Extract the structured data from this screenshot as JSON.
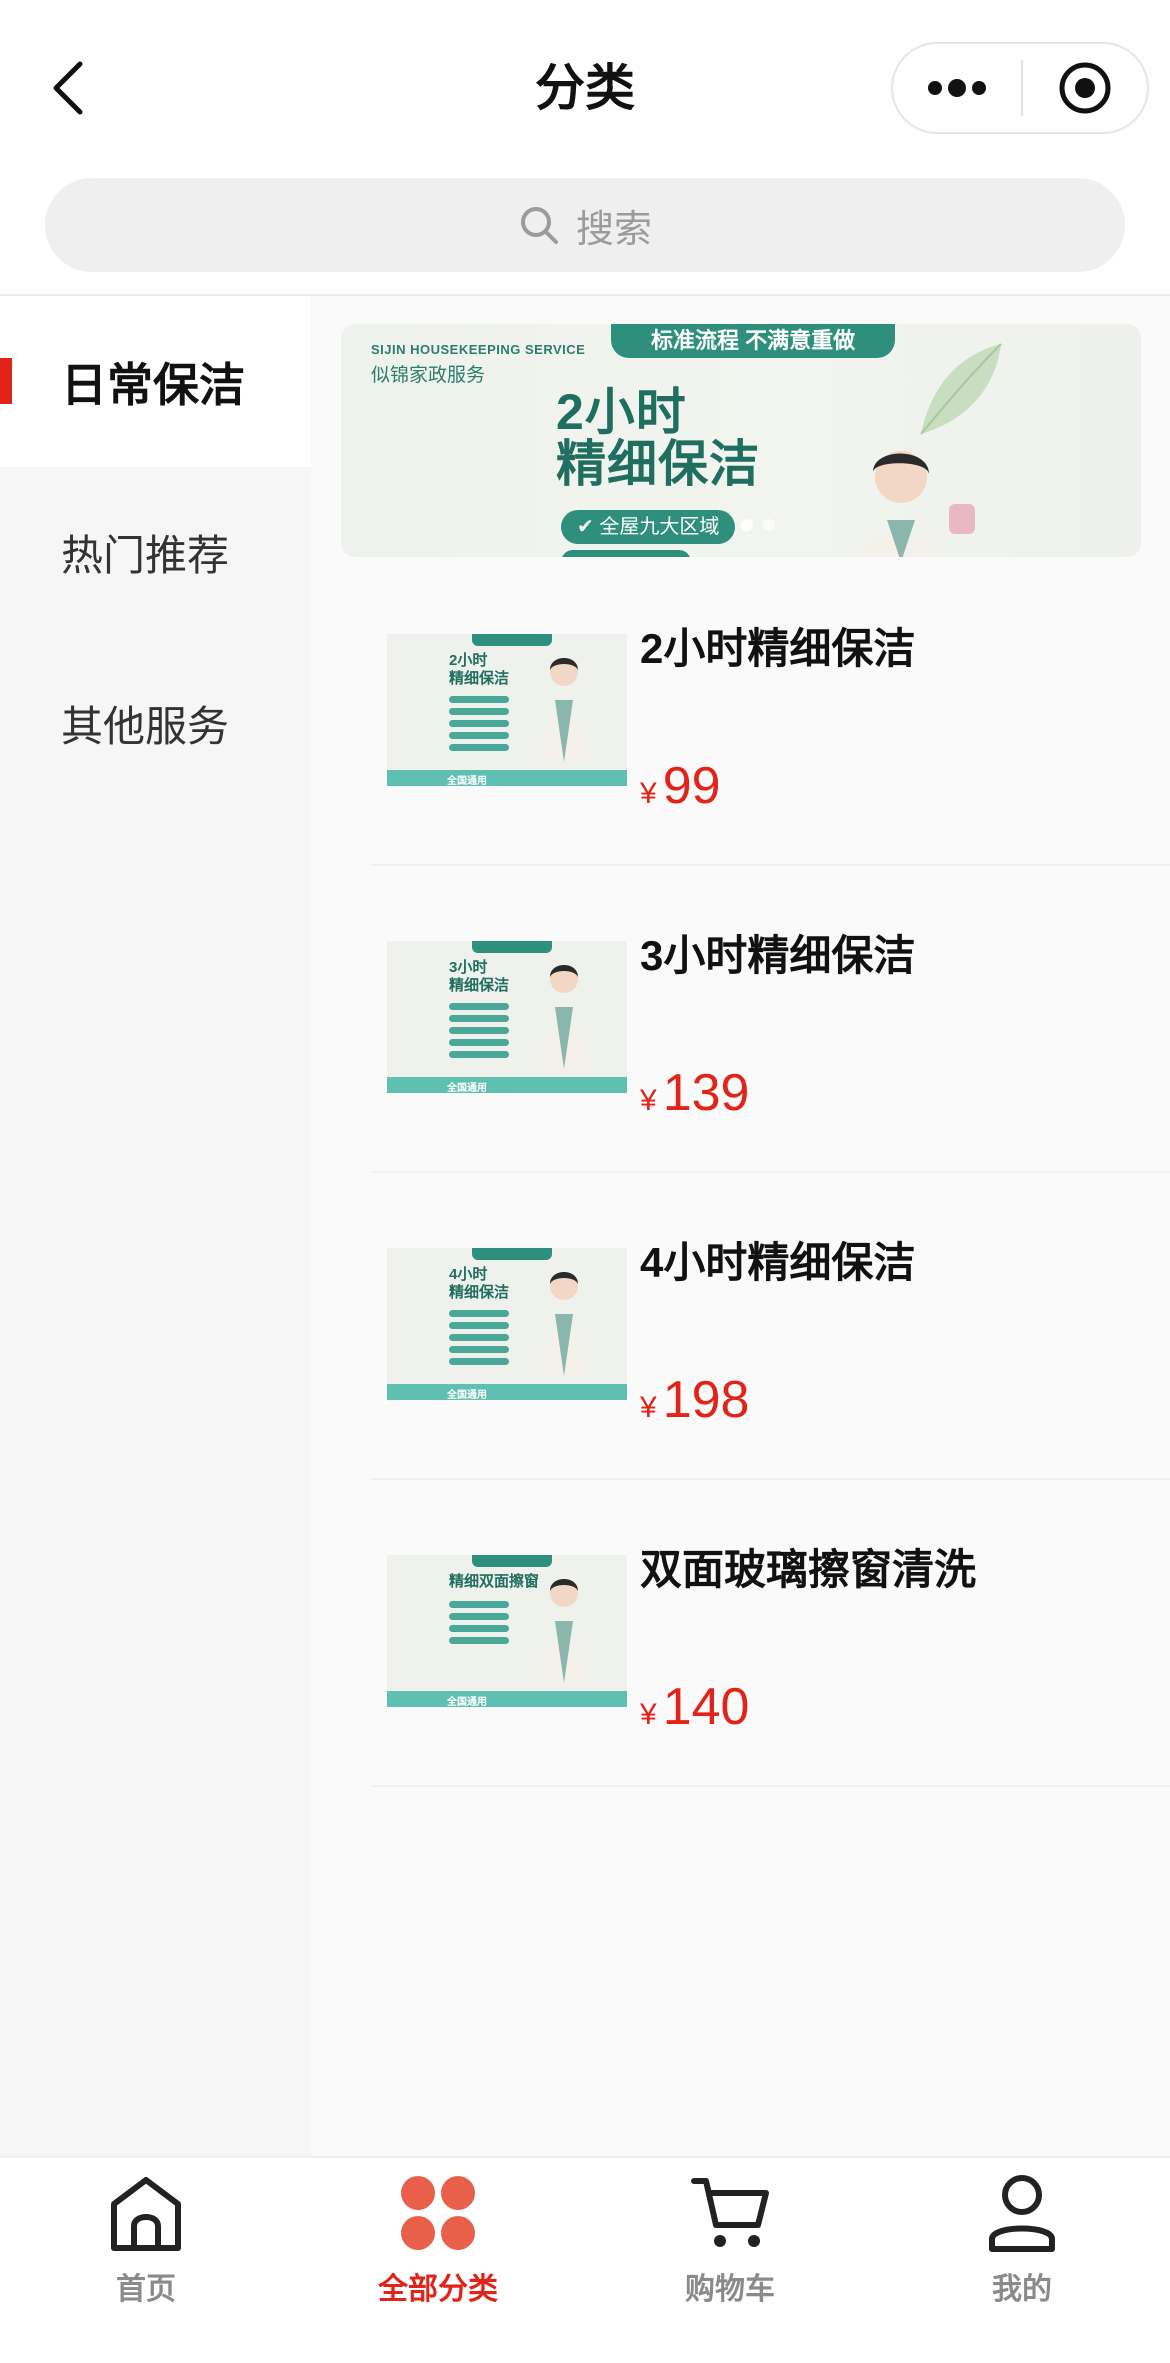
{
  "header": {
    "title": "分类",
    "back_icon": "chevron-left-icon",
    "more_icon": "more-dots-icon",
    "close_icon": "target-close-icon"
  },
  "search": {
    "placeholder": "搜索",
    "icon": "search-icon"
  },
  "sidebar": {
    "items": [
      {
        "label": "日常保洁",
        "active": true
      },
      {
        "label": "热门推荐",
        "active": false
      },
      {
        "label": "其他服务",
        "active": false
      }
    ]
  },
  "banner": {
    "tag": "标准流程  不满意重做",
    "brand_en": "SIJIN HOUSEKEEPING SERVICE",
    "brand_cn": "似锦家政服务",
    "headline": "2小时\n精细保洁",
    "pill": "全屋九大区域"
  },
  "products": [
    {
      "name": "2小时精细保洁",
      "currency": "¥",
      "price": "99",
      "thumb_title": "2小时\n精细保洁"
    },
    {
      "name": "3小时精细保洁",
      "currency": "¥",
      "price": "139",
      "thumb_title": "3小时\n精细保洁"
    },
    {
      "name": "4小时精细保洁",
      "currency": "¥",
      "price": "198",
      "thumb_title": "4小时\n精细保洁"
    },
    {
      "name": "双面玻璃擦窗清洗",
      "currency": "¥",
      "price": "140",
      "thumb_title": "精细双面擦窗"
    }
  ],
  "tabbar": {
    "tabs": [
      {
        "label": "首页",
        "icon": "home-icon",
        "active": false
      },
      {
        "label": "全部分类",
        "icon": "category-dots-icon",
        "active": true
      },
      {
        "label": "购物车",
        "icon": "cart-icon",
        "active": false
      },
      {
        "label": "我的",
        "icon": "user-icon",
        "active": false
      }
    ]
  },
  "colors": {
    "accent": "#e2231a",
    "brand_green": "#2f8f7d",
    "sidebar_bg": "#f6f6f6"
  }
}
